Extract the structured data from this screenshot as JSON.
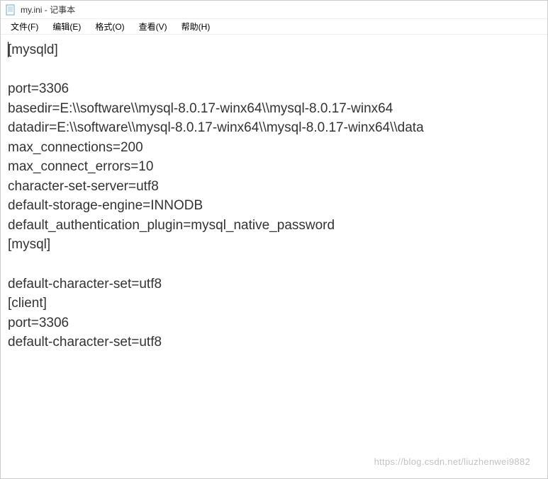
{
  "titlebar": {
    "title": "my.ini - 记事本",
    "icon": "notepad-icon"
  },
  "menubar": {
    "items": [
      {
        "label": "文件(F)"
      },
      {
        "label": "编辑(E)"
      },
      {
        "label": "格式(O)"
      },
      {
        "label": "查看(V)"
      },
      {
        "label": "帮助(H)"
      }
    ]
  },
  "editor": {
    "content": "[mysqld]\n\nport=3306\nbasedir=E:\\\\software\\\\mysql-8.0.17-winx64\\\\mysql-8.0.17-winx64\ndatadir=E:\\\\software\\\\mysql-8.0.17-winx64\\\\mysql-8.0.17-winx64\\\\data\nmax_connections=200\nmax_connect_errors=10\ncharacter-set-server=utf8\ndefault-storage-engine=INNODB\ndefault_authentication_plugin=mysql_native_password\n[mysql]\n\ndefault-character-set=utf8\n[client]\nport=3306\ndefault-character-set=utf8"
  },
  "watermark": {
    "text": "https://blog.csdn.net/liuzhenwei9882"
  }
}
